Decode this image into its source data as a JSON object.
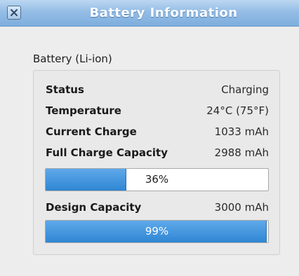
{
  "window": {
    "title": "Battery Information",
    "close_icon": "close-icon"
  },
  "battery_frame": {
    "label": "Battery (Li-ion)",
    "rows": {
      "status": {
        "label": "Status",
        "value": "Charging"
      },
      "temperature": {
        "label": "Temperature",
        "value": "24°C (75°F)"
      },
      "current_charge": {
        "label": "Current Charge",
        "value": "1033 mAh"
      },
      "full_charge_capacity": {
        "label": "Full Charge Capacity",
        "value": "2988 mAh"
      },
      "design_capacity": {
        "label": "Design Capacity",
        "value": "3000 mAh"
      }
    },
    "charge_bar": {
      "text": "36%",
      "fraction": 0.36
    },
    "health_bar": {
      "text": "99%",
      "fraction": 0.99
    }
  },
  "colors": {
    "titlebar": "#94bde6",
    "progress_fill": "#3a8edb"
  }
}
